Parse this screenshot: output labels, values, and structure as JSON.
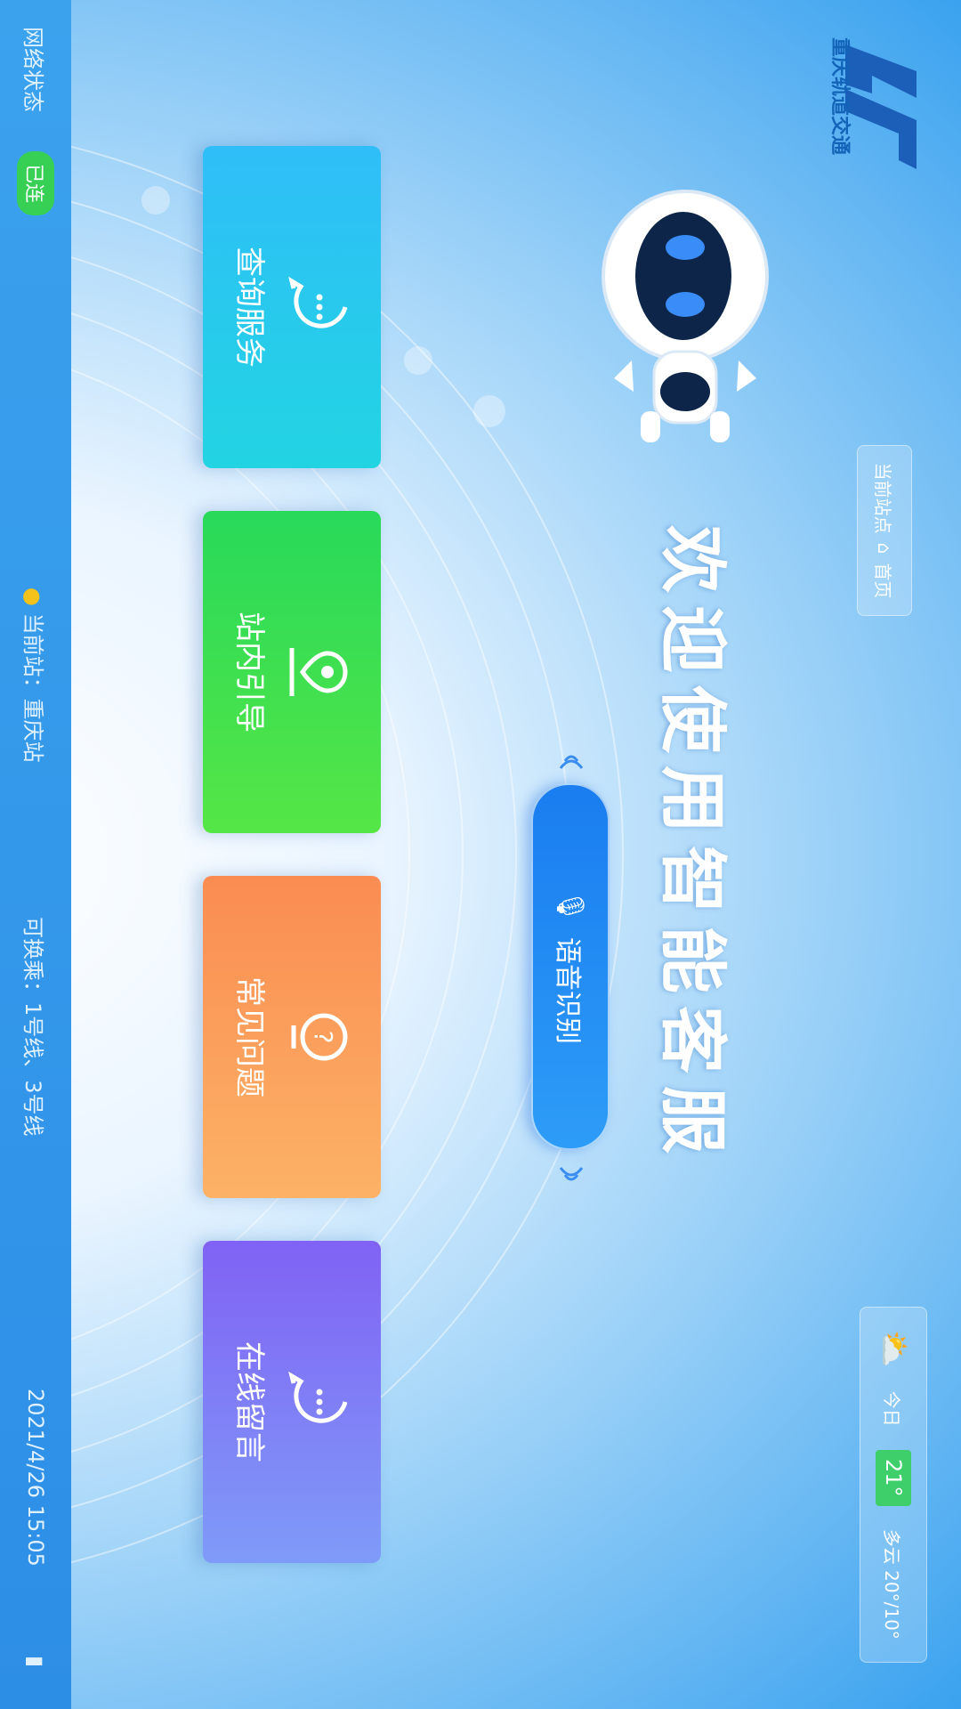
{
  "header": {
    "breadcrumb_station": "当前站点",
    "home_label": "首页",
    "weather": {
      "icon": "cloudy-sun-icon",
      "day_label": "今日",
      "temperature": "21°",
      "condition": "多云 20°/10°"
    }
  },
  "logo": {
    "name": "重庆轨道交通"
  },
  "title": "欢迎使用智能客服",
  "voice_button": {
    "label": "语音识别",
    "icon": "microphone-icon"
  },
  "cards": [
    {
      "label": "查询服务",
      "icon": "chat-bubble-icon",
      "color": "#2bc4f3"
    },
    {
      "label": "站内引导",
      "icon": "map-pin-icon",
      "color": "#3ede52"
    },
    {
      "label": "常见问题",
      "icon": "question-icon",
      "color": "#fb9e5c"
    },
    {
      "label": "在线留言",
      "icon": "chat-bubble-icon",
      "color": "#7f7ef7"
    }
  ],
  "status_bar": {
    "network_label": "网络状态",
    "network_status": "已连",
    "current_station_label": "当前站：重庆站",
    "exits_label": "可换乘：1号线、3号线",
    "datetime": "2021/4/26 15:05"
  }
}
